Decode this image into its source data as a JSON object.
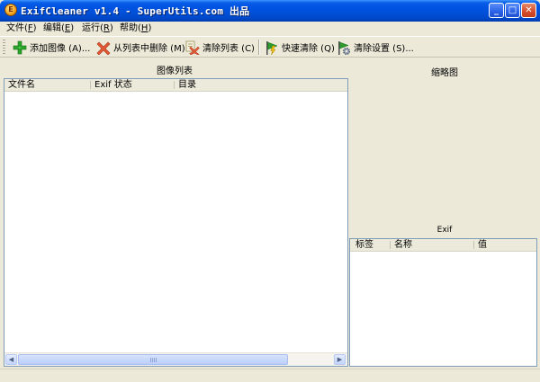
{
  "window": {
    "title": "ExifCleaner v1.4 - SuperUtils.com 出品",
    "app_icon_letter": "E",
    "controls": {
      "minimize": "_",
      "maximize": "□",
      "close": "✕"
    }
  },
  "menu": [
    {
      "label": "文件",
      "key": "F"
    },
    {
      "label": "编辑",
      "key": "E"
    },
    {
      "label": "运行",
      "key": "R"
    },
    {
      "label": "帮助",
      "key": "H"
    }
  ],
  "toolbar": {
    "add_images": "添加图像 (A)...",
    "remove_from_list": "从列表中删除 (M)",
    "clear_list": "清除列表 (C)",
    "quick_clean": "快速清除 (Q)",
    "clean_settings": "清除设置 (S)..."
  },
  "image_list": {
    "title": "图像列表",
    "columns": [
      "文件名",
      "Exif 状态",
      "目录"
    ],
    "rows": []
  },
  "thumbnail": {
    "title": "缩略图"
  },
  "exif": {
    "title": "Exif",
    "columns": [
      "标签",
      "名称",
      "值"
    ],
    "rows": []
  },
  "colors": {
    "titlebar": "#0054e3",
    "window_bg": "#ece9d8",
    "list_border": "#7f9db9"
  },
  "icons": {
    "add": "green-plus-icon",
    "remove": "red-x-icon",
    "clear": "clear-list-icon",
    "quick": "lightning-flag-icon",
    "settings": "gear-flag-icon"
  }
}
